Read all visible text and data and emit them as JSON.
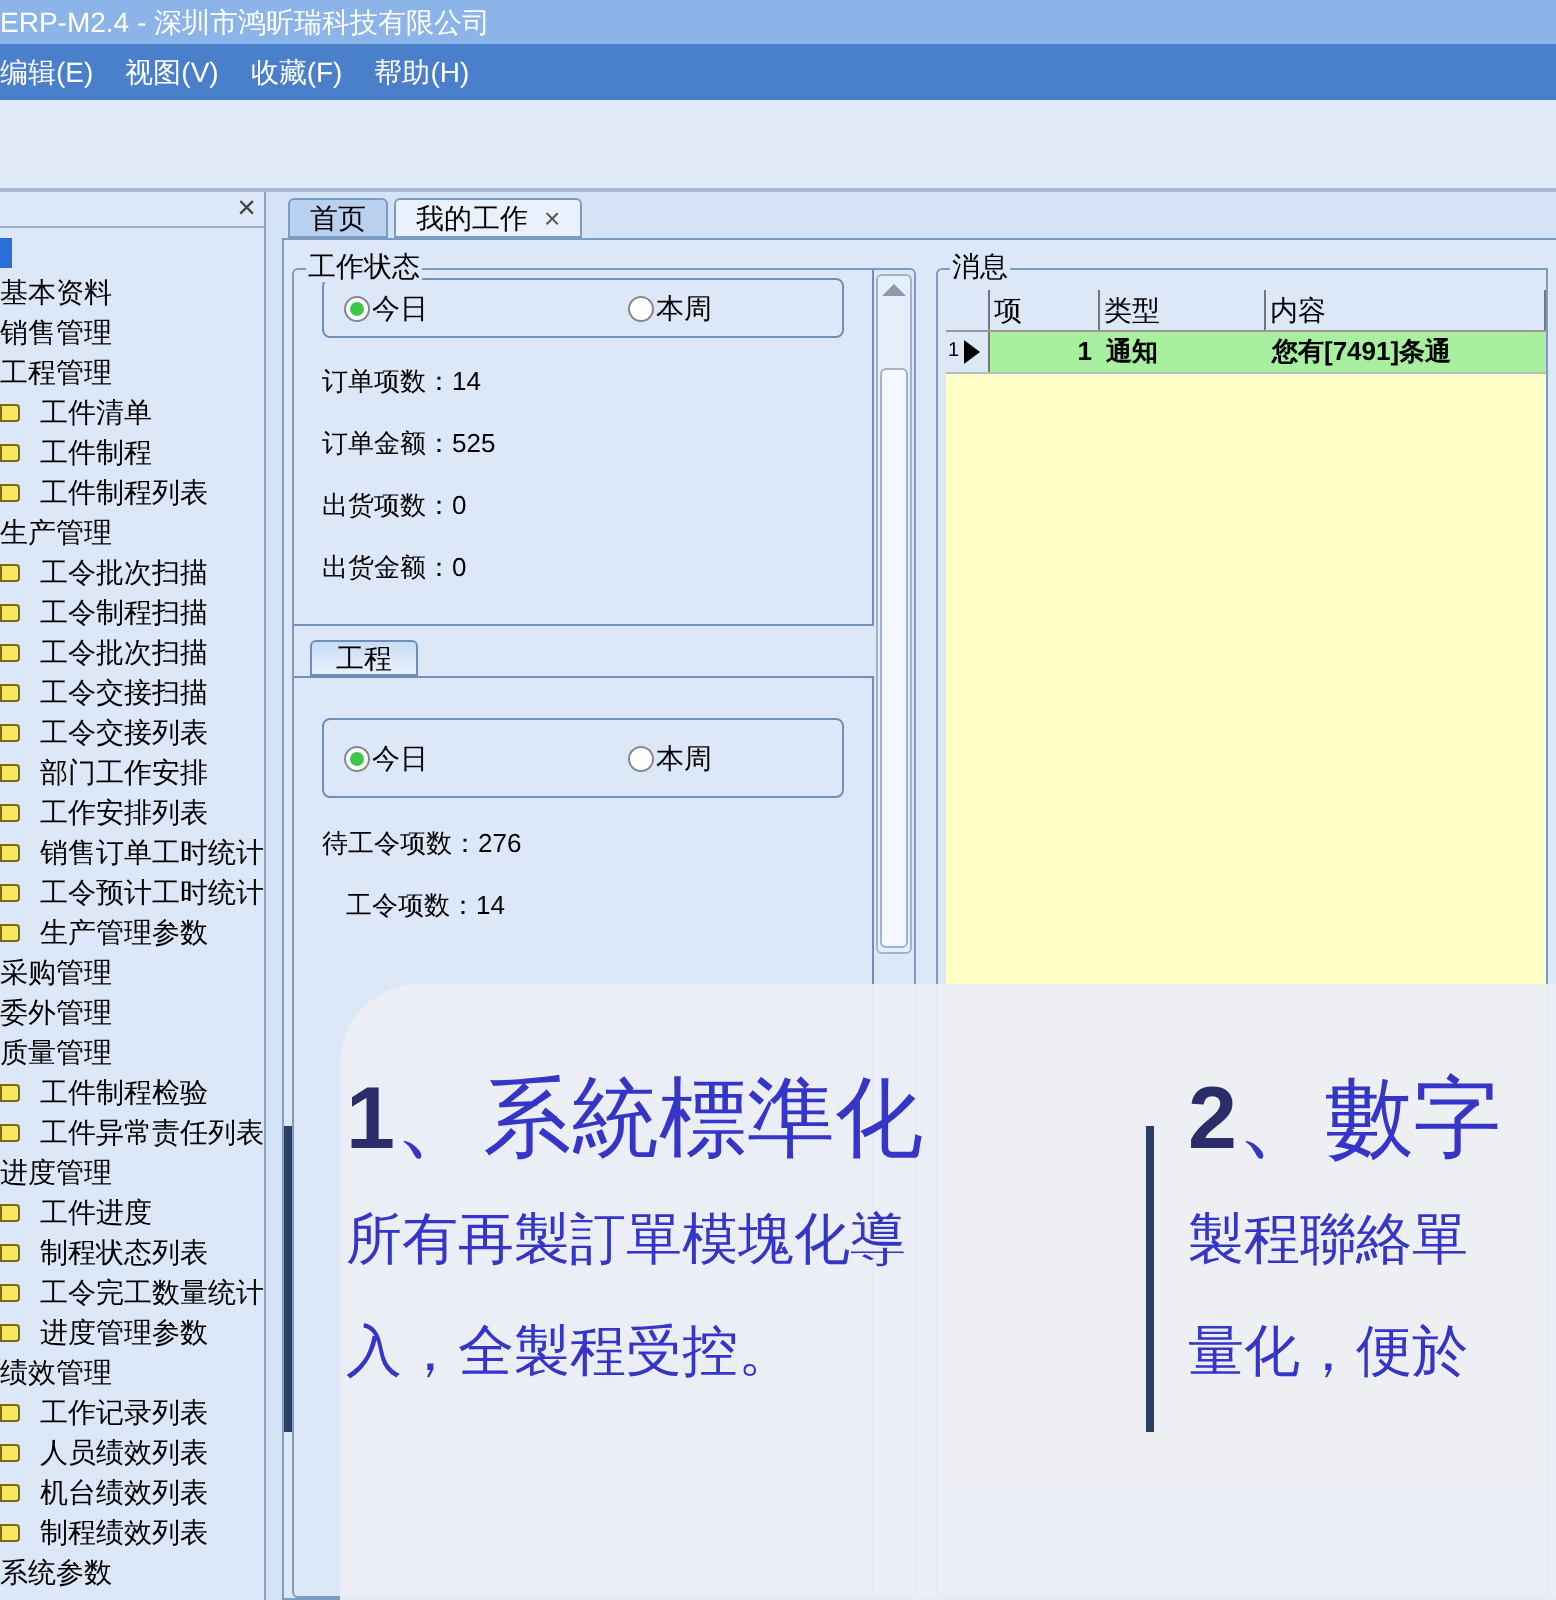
{
  "window": {
    "title": "ERP-M2.4 - 深圳市鸿昕瑞科技有限公司"
  },
  "menu": [
    {
      "label": "编辑(E)"
    },
    {
      "label": "视图(V)"
    },
    {
      "label": "收藏(F)"
    },
    {
      "label": "帮助(H)"
    }
  ],
  "sidebar": {
    "close": "×",
    "root": {
      "selected": true
    },
    "tree": [
      {
        "label": "基本资料"
      },
      {
        "label": "销售管理"
      },
      {
        "label": "工程管理",
        "children": [
          {
            "label": "工件清单"
          },
          {
            "label": "工件制程"
          },
          {
            "label": "工件制程列表"
          }
        ]
      },
      {
        "label": "生产管理",
        "children": [
          {
            "label": "工令批次扫描"
          },
          {
            "label": "工令制程扫描"
          },
          {
            "label": "工令批次扫描"
          },
          {
            "label": "工令交接扫描"
          },
          {
            "label": "工令交接列表"
          },
          {
            "label": "部门工作安排"
          },
          {
            "label": "工作安排列表"
          },
          {
            "label": "销售订单工时统计"
          },
          {
            "label": "工令预计工时统计"
          },
          {
            "label": "生产管理参数"
          }
        ]
      },
      {
        "label": "采购管理"
      },
      {
        "label": "委外管理"
      },
      {
        "label": "质量管理",
        "children": [
          {
            "label": "工件制程检验"
          },
          {
            "label": "工件异常责任列表"
          }
        ]
      },
      {
        "label": "进度管理",
        "children": [
          {
            "label": "工件进度"
          },
          {
            "label": "制程状态列表"
          },
          {
            "label": "工令完工数量统计"
          },
          {
            "label": "进度管理参数"
          }
        ]
      },
      {
        "label": "绩效管理",
        "children": [
          {
            "label": "工作记录列表"
          },
          {
            "label": "人员绩效列表"
          },
          {
            "label": "机台绩效列表"
          },
          {
            "label": "制程绩效列表"
          }
        ]
      },
      {
        "label": "系统参数"
      }
    ]
  },
  "tabs": [
    {
      "label": "首页",
      "selected": false
    },
    {
      "label": "我的工作",
      "selected": true,
      "close": "×"
    }
  ],
  "work_status": {
    "legend": "工作状态",
    "radios": [
      {
        "label": "今日",
        "selected": true
      },
      {
        "label": "本周",
        "selected": false
      }
    ],
    "stats": [
      {
        "text": "订单项数：14"
      },
      {
        "text": "订单金额：525"
      },
      {
        "text": "出货项数：0"
      },
      {
        "text": "出货金额：0"
      }
    ]
  },
  "engineering": {
    "tab": "工程",
    "radios": [
      {
        "label": "今日",
        "selected": true
      },
      {
        "label": "本周",
        "selected": false
      }
    ],
    "stats": [
      {
        "text": "待工令项数：276"
      },
      {
        "text": "工令项数：14"
      }
    ]
  },
  "messages": {
    "legend": "消息",
    "columns": [
      "项",
      "类型",
      "内容"
    ],
    "rows": [
      {
        "index": "1",
        "selected": true,
        "cells": [
          "1",
          "通知",
          "您有[7491]条通"
        ]
      }
    ]
  },
  "overlay": {
    "columns": [
      {
        "number": "1",
        "title": "、系統標準化",
        "body": [
          "所有再製訂單模塊化導",
          "入，全製程受控。"
        ]
      },
      {
        "number": "2",
        "title": "、數字",
        "body": [
          "製程聯絡單",
          "量化，便於"
        ]
      }
    ]
  }
}
